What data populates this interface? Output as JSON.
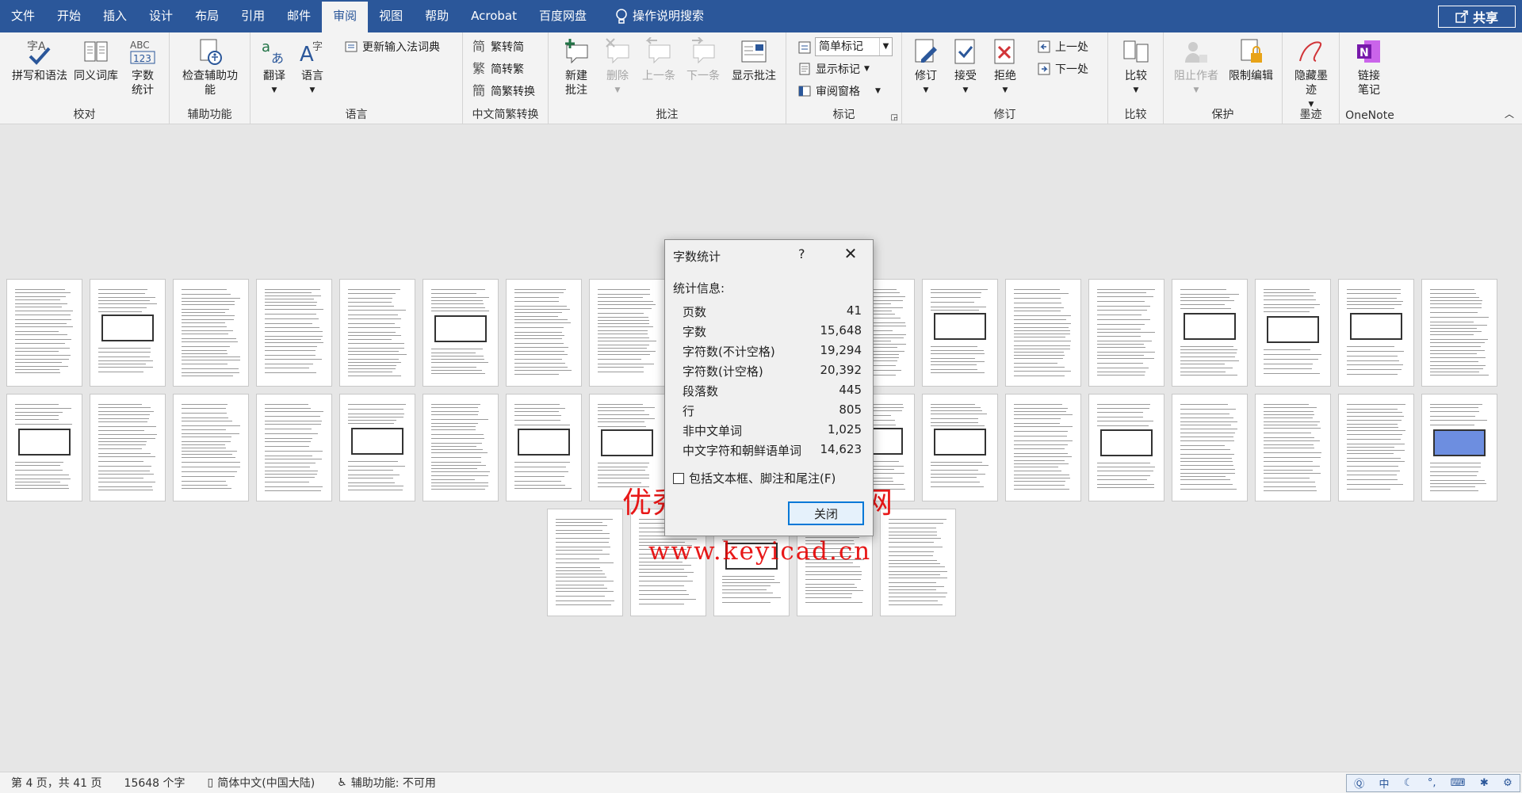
{
  "menubar": {
    "tabs": [
      "文件",
      "开始",
      "插入",
      "设计",
      "布局",
      "引用",
      "邮件",
      "审阅",
      "视图",
      "帮助",
      "Acrobat",
      "百度网盘"
    ],
    "active": "审阅",
    "search": "操作说明搜索",
    "share": "共享"
  },
  "ribbon": {
    "proofing": {
      "label": "校对",
      "spell": "拼写和语法",
      "thesaurus": "同义词库",
      "wordcount": "字数统计"
    },
    "accessibility": {
      "label": "辅助功能",
      "check": "检查辅助功能"
    },
    "language": {
      "label": "语言",
      "translate": "翻译",
      "language": "语言",
      "update_ime": "更新输入法词典"
    },
    "chinese": {
      "label": "中文简繁转换",
      "to_trad": "繁转简",
      "to_simp": "简转繁",
      "convert": "简繁转换"
    },
    "comments": {
      "label": "批注",
      "new": "新建批注",
      "delete": "删除",
      "prev": "上一条",
      "next": "下一条",
      "show": "显示批注"
    },
    "tracking": {
      "label": "标记",
      "markup": "简单标记",
      "show_markup": "显示标记",
      "pane": "审阅窗格"
    },
    "changes": {
      "label": "修订",
      "track": "修订",
      "accept": "接受",
      "reject": "拒绝",
      "prev": "上一处",
      "next": "下一处"
    },
    "compare": {
      "label": "比较",
      "compare": "比较"
    },
    "protect": {
      "label": "保护",
      "block": "阻止作者",
      "restrict": "限制编辑"
    },
    "ink": {
      "label": "墨迹",
      "hide": "隐藏墨迹"
    },
    "onenote": {
      "label": "OneNote",
      "link": "链接笔记"
    }
  },
  "dialog": {
    "title": "字数统计",
    "help": "?",
    "section": "统计信息:",
    "stats": [
      {
        "label": "页数",
        "value": "41"
      },
      {
        "label": "字数",
        "value": "15,648"
      },
      {
        "label": "字符数(不计空格)",
        "value": "19,294"
      },
      {
        "label": "字符数(计空格)",
        "value": "20,392"
      },
      {
        "label": "段落数",
        "value": "445"
      },
      {
        "label": "行",
        "value": "805"
      },
      {
        "label": "非中文单词",
        "value": "1,025"
      },
      {
        "label": "中文字符和朝鲜语单词",
        "value": "14,623"
      }
    ],
    "checkbox": "包括文本框、脚注和尾注(F)",
    "close": "关闭"
  },
  "watermark": {
    "line1": "优秀毕业设计资源网",
    "line2": "www.keyicad.cn"
  },
  "status": {
    "page": "第 4 页，共 41 页",
    "words": "15648 个字",
    "lang": "简体中文(中国大陆)",
    "a11y": "辅助功能: 不可用"
  },
  "ime": {
    "mode": "中"
  },
  "colors": {
    "brand": "#2b579a",
    "watermark": "#e60000"
  }
}
